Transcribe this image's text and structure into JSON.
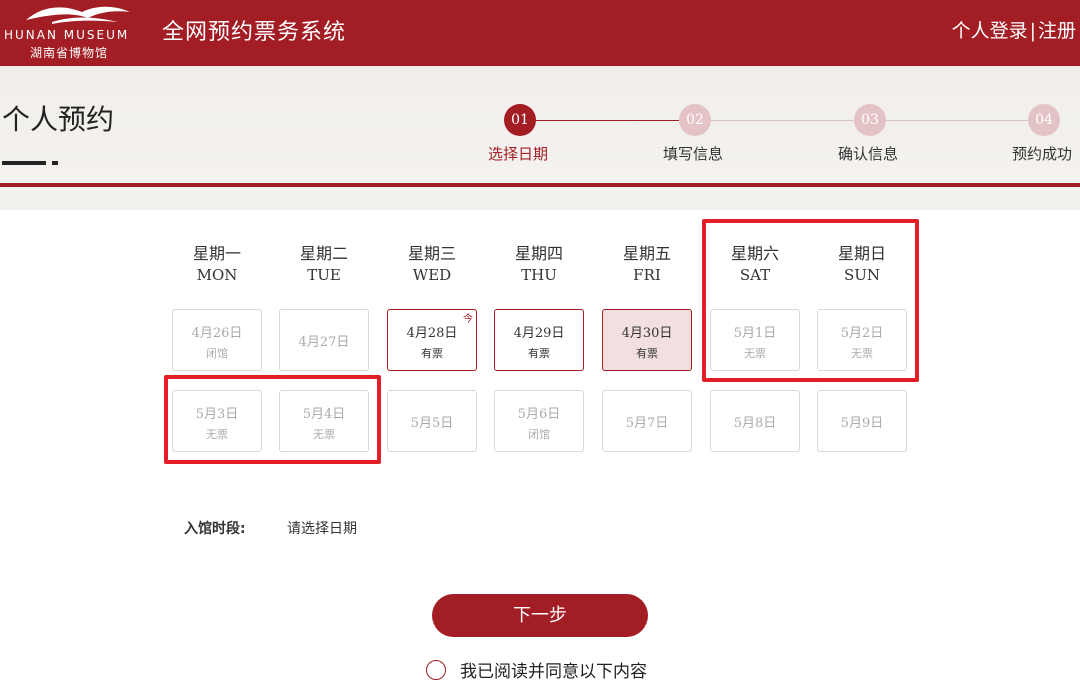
{
  "header": {
    "logo_en": "HUNAN MUSEUM",
    "logo_cn": "湖南省博物馆",
    "app_title": "全网预约票务系统",
    "login": "个人登录",
    "separator": "|",
    "register": "注册"
  },
  "page": {
    "title": "个人预约"
  },
  "steps": [
    {
      "num": "01",
      "label": "选择日期",
      "active": true
    },
    {
      "num": "02",
      "label": "填写信息",
      "active": false
    },
    {
      "num": "03",
      "label": "确认信息",
      "active": false
    },
    {
      "num": "04",
      "label": "预约成功",
      "active": false
    }
  ],
  "weekdays": [
    {
      "cn": "星期一",
      "en": "MON"
    },
    {
      "cn": "星期二",
      "en": "TUE"
    },
    {
      "cn": "星期三",
      "en": "WED"
    },
    {
      "cn": "星期四",
      "en": "THU"
    },
    {
      "cn": "星期五",
      "en": "FRI"
    },
    {
      "cn": "星期六",
      "en": "SAT"
    },
    {
      "cn": "星期日",
      "en": "SUN"
    }
  ],
  "calendar": {
    "today_mark": "今",
    "week1": [
      {
        "date": "4月26日",
        "status": "闭馆",
        "state": "disabled"
      },
      {
        "date": "4月27日",
        "status": "",
        "state": "disabled"
      },
      {
        "date": "4月28日",
        "status": "有票",
        "state": "available",
        "today": true
      },
      {
        "date": "4月29日",
        "status": "有票",
        "state": "available"
      },
      {
        "date": "4月30日",
        "status": "有票",
        "state": "selected"
      },
      {
        "date": "5月1日",
        "status": "无票",
        "state": "disabled"
      },
      {
        "date": "5月2日",
        "status": "无票",
        "state": "disabled"
      }
    ],
    "week2": [
      {
        "date": "5月3日",
        "status": "无票",
        "state": "disabled"
      },
      {
        "date": "5月4日",
        "status": "无票",
        "state": "disabled"
      },
      {
        "date": "5月5日",
        "status": "",
        "state": "disabled"
      },
      {
        "date": "5月6日",
        "status": "闭馆",
        "state": "disabled"
      },
      {
        "date": "5月7日",
        "status": "",
        "state": "disabled"
      },
      {
        "date": "5月8日",
        "status": "",
        "state": "disabled"
      },
      {
        "date": "5月9日",
        "status": "",
        "state": "disabled"
      }
    ]
  },
  "entry_time": {
    "label": "入馆时段:",
    "value": "请选择日期"
  },
  "actions": {
    "next": "下一步",
    "agree": "我已阅读并同意以下内容"
  },
  "colors": {
    "brand_red": "#a31d24",
    "highlight_red": "#e21e26",
    "step_inactive": "#e4c3c6",
    "selected_bg": "#f2dfe0"
  }
}
